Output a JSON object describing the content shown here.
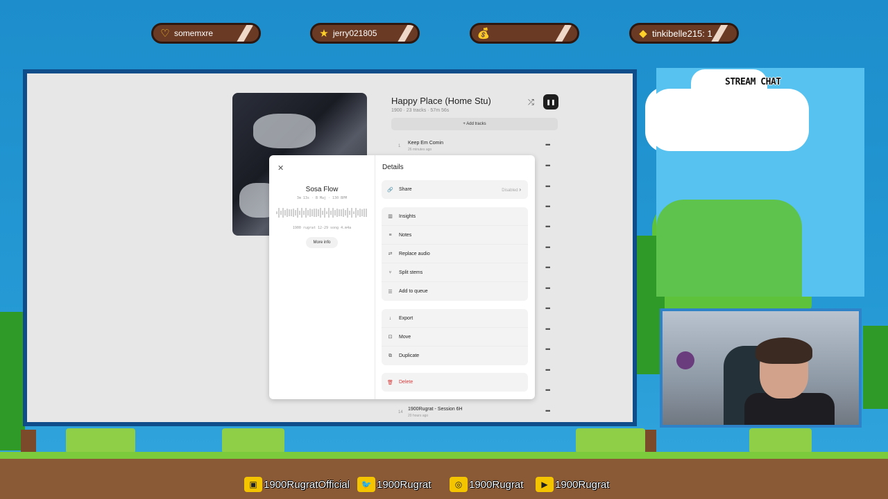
{
  "alerts": [
    {
      "icon": "heart-icon",
      "glyph": "♡",
      "text": "somemxre"
    },
    {
      "icon": "star-icon",
      "glyph": "★",
      "text": "jerry021805"
    },
    {
      "icon": "money-bag-icon",
      "glyph": "💰",
      "text": ""
    },
    {
      "icon": "diamond-icon",
      "glyph": "◆",
      "text": "tinkibelle215: 1"
    }
  ],
  "playlist": {
    "title": "Happy Place (Home Stu)",
    "meta": "1900 · 23 tracks · 57m 56s",
    "add_tracks": "+ Add tracks",
    "tracks": [
      {
        "num": "1",
        "name": "Keep Em Comin",
        "sub": "26 minutes ago"
      },
      {
        "num": "14",
        "name": "1900Rugrat - Session 6H",
        "sub": "20 hours ago"
      }
    ]
  },
  "modal": {
    "song_title": "Sosa Flow",
    "song_info": "3m 13s · B Maj · 130 BPM",
    "file_name": "1900 rugrat 12-29 song 4.m4a",
    "more_info": "More info",
    "details_title": "Details",
    "share": {
      "label": "Share",
      "status": "Disabled"
    },
    "group1": [
      "Insights",
      "Notes",
      "Replace audio",
      "Split stems",
      "Add to queue"
    ],
    "group2": [
      "Export",
      "Move",
      "Duplicate"
    ],
    "delete": "Delete"
  },
  "chat": {
    "title": "STREAM CHAT"
  },
  "socials": [
    {
      "icon": "twitch-icon",
      "handle": "1900RugratOfficial"
    },
    {
      "icon": "twitter-icon",
      "handle": "1900Rugrat"
    },
    {
      "icon": "instagram-icon",
      "handle": "1900Rugrat"
    },
    {
      "icon": "youtube-icon",
      "handle": "1900Rugrat"
    }
  ],
  "colors": {
    "accent": "#0f4d8a",
    "danger": "#d93a3a",
    "sky": "#1d8ecb",
    "grass": "#7ccb3c"
  }
}
